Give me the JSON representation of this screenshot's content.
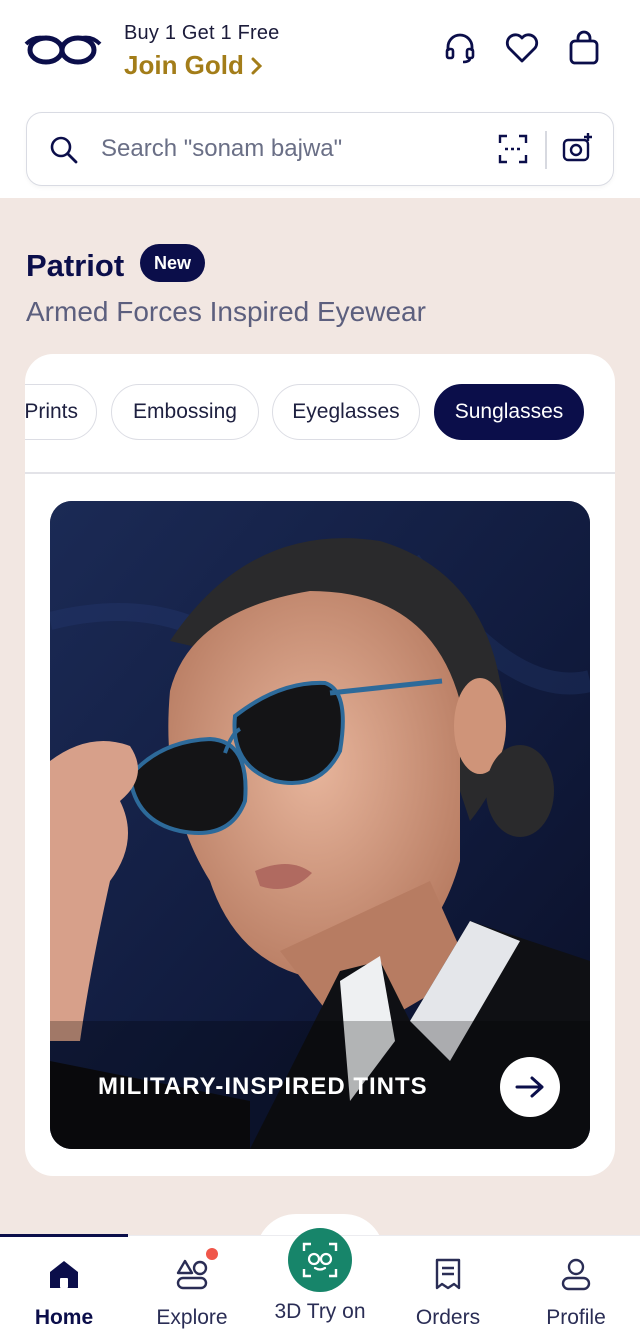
{
  "header": {
    "promo_line": "Buy 1 Get 1 Free",
    "promo_cta": "Join Gold",
    "icons": [
      "support-headset-icon",
      "wishlist-heart-icon",
      "cart-bag-icon"
    ]
  },
  "search": {
    "placeholder": "Search \"sonam bajwa\""
  },
  "collection": {
    "title": "Patriot",
    "badge": "New",
    "subtitle": "Armed Forces Inspired Eyewear"
  },
  "chips": [
    {
      "label": "Prints",
      "active": false
    },
    {
      "label": "Embossing",
      "active": false
    },
    {
      "label": "Eyeglasses",
      "active": false
    },
    {
      "label": "Sunglasses",
      "active": true
    }
  ],
  "hero": {
    "label": "MILITARY-INSPIRED TINTS"
  },
  "nav": {
    "items": [
      {
        "label": "Home",
        "active": true
      },
      {
        "label": "Explore",
        "active": false
      },
      {
        "label": "3D Try on",
        "active": false
      },
      {
        "label": "Orders",
        "active": false
      },
      {
        "label": "Profile",
        "active": false
      }
    ]
  },
  "colors": {
    "navy": "#0b0e4a",
    "gold": "#a37d19",
    "background": "#f2e7e2",
    "tryon_green": "#17856a",
    "notification_dot": "#f0564a"
  }
}
